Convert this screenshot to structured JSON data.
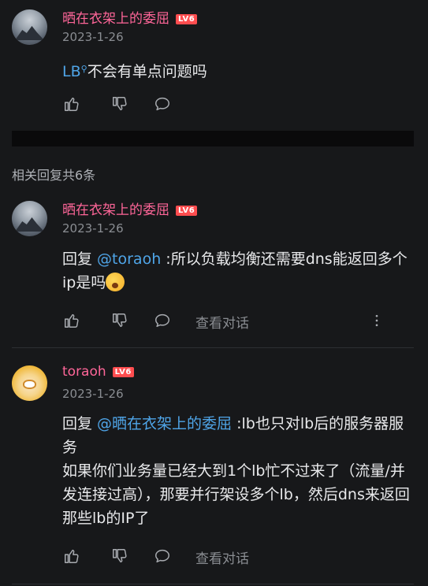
{
  "main_comment": {
    "username": "晒在衣架上的委屈",
    "level": "LV6",
    "date": "2023-1-26",
    "text_link": "LB",
    "text": "不会有单点问题吗"
  },
  "replies_header": "相关回复共6条",
  "replies": [
    {
      "username": "晒在衣架上的委屈",
      "level": "LV6",
      "date": "2023-1-26",
      "reply_prefix": "回复 ",
      "mention": "@toraoh",
      "text": " :所以负载均衡还需要dns能返回多个ip是吗",
      "view_conversation": "查看对话"
    },
    {
      "username": "toraoh",
      "level": "LV6",
      "date": "2023-1-26",
      "reply_prefix": "回复 ",
      "mention": "@晒在衣架上的委屈",
      "text": " :lb也只对lb后的服务器服务",
      "text2": "如果你们业务量已经大到1个lb忙不过来了（流量/并发连接过高），那要并行架设多个lb，然后dns来返回那些lb的IP了",
      "view_conversation": "查看对话"
    }
  ],
  "colors": {
    "username": "#ff6699",
    "mention": "#4fa5e8",
    "level_badge": "#ff4d4f",
    "background": "#17181a"
  },
  "icons": [
    "thumbs-up-icon",
    "thumbs-down-icon",
    "comment-icon",
    "more-vertical-icon"
  ]
}
